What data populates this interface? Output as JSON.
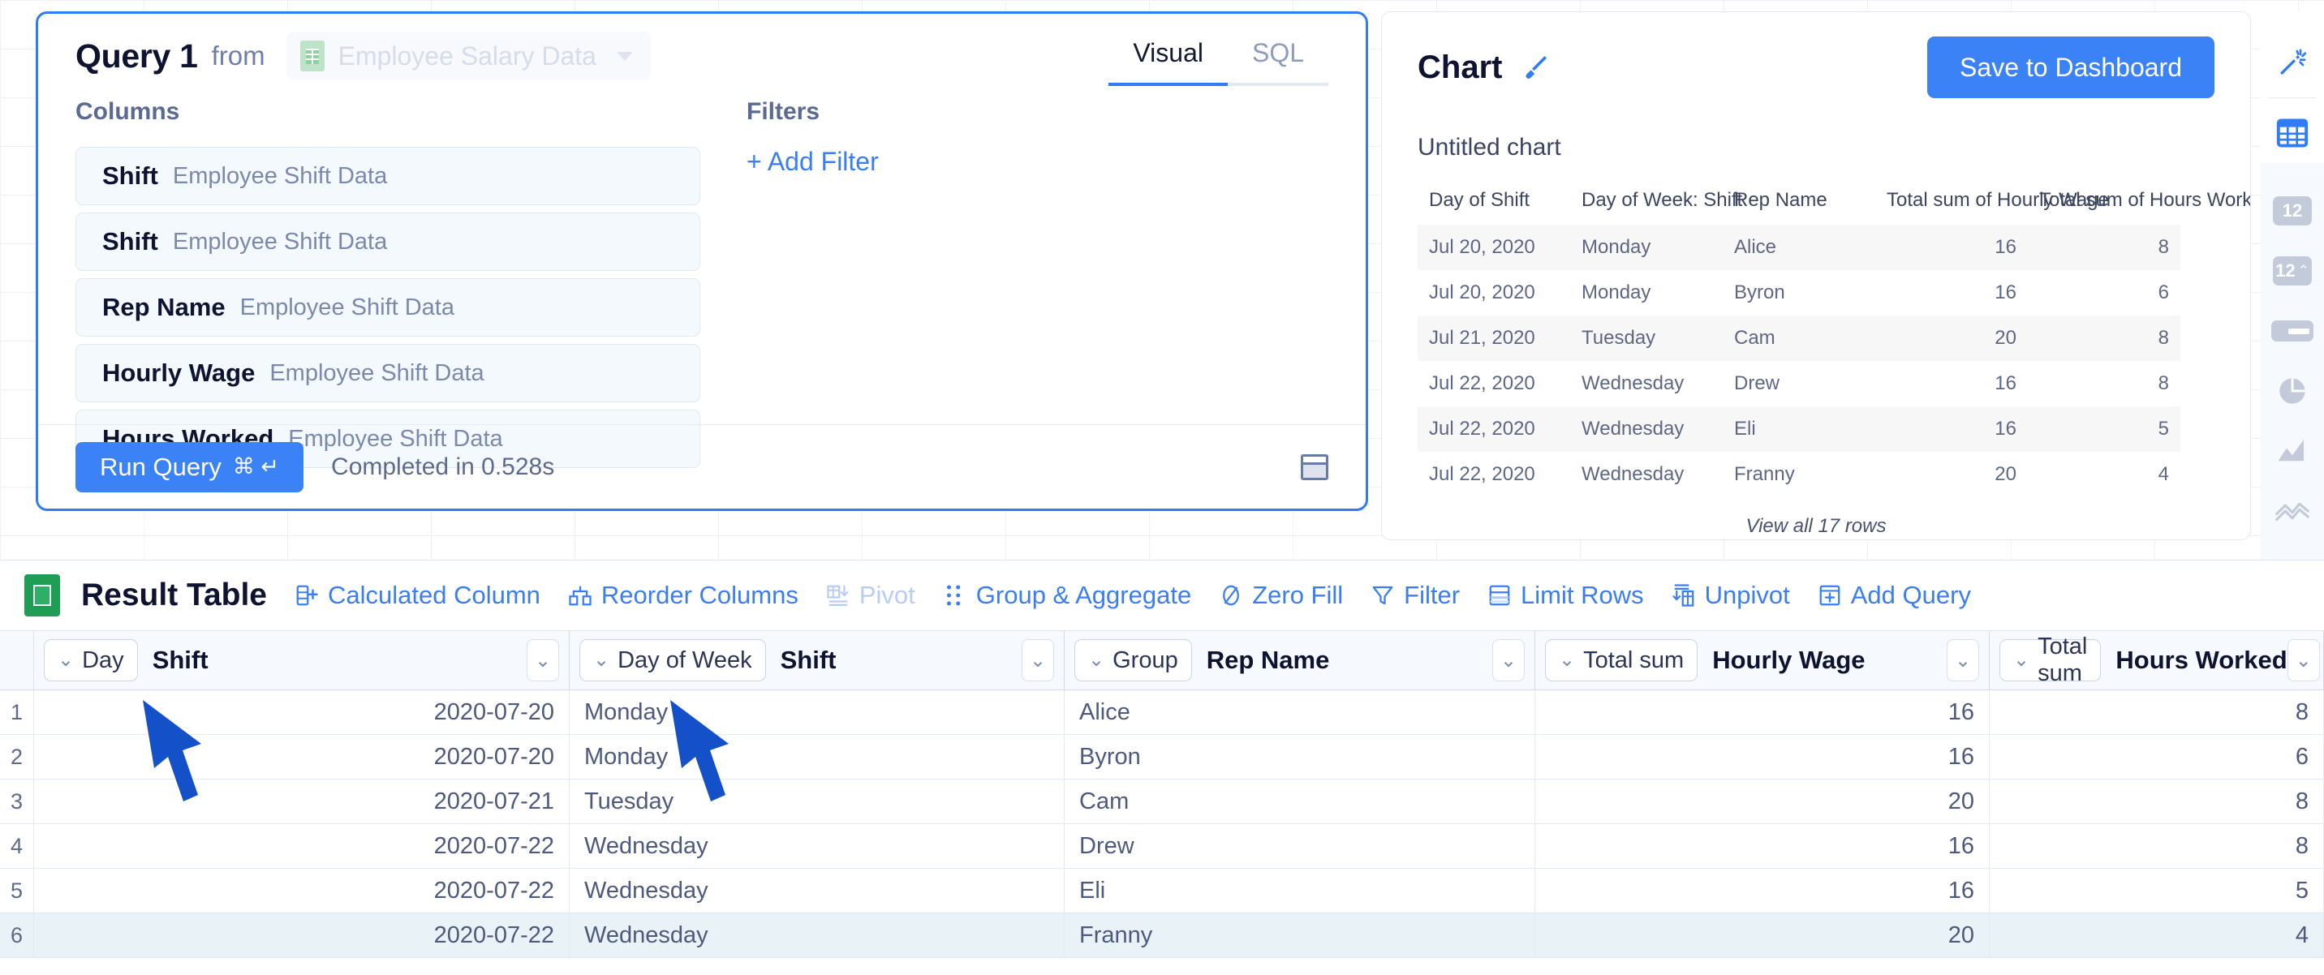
{
  "query": {
    "title": "Query 1",
    "from_label": "from",
    "source_name": "Employee Salary Data",
    "source_icon": "sheet-icon",
    "tabs": [
      {
        "label": "Visual",
        "active": true
      },
      {
        "label": "SQL",
        "active": false
      }
    ],
    "columns_label": "Columns",
    "columns": [
      {
        "name": "Shift",
        "source": "Employee Shift Data"
      },
      {
        "name": "Shift",
        "source": "Employee Shift Data"
      },
      {
        "name": "Rep Name",
        "source": "Employee Shift Data"
      },
      {
        "name": "Hourly Wage",
        "source": "Employee Shift Data"
      },
      {
        "name": "Hours Worked",
        "source": "Employee Shift Data"
      }
    ],
    "filters_label": "Filters",
    "add_filter_label": "+ Add Filter",
    "run_button_label": "Run Query",
    "run_button_shortcut": "⌘ ↵",
    "status": "Completed in 0.528s",
    "panel_toggle_icon": "panel-icon"
  },
  "chart": {
    "title": "Chart",
    "edit_icon": "paintbrush-icon",
    "save_button_label": "Save to Dashboard",
    "chart_name": "Untitled chart",
    "view_all_label": "View all 17 rows",
    "preview": {
      "headers": [
        "Day of Shift",
        "Day of Week: Shift",
        "Rep Name",
        "Total sum of Hourly Wage",
        "Total sum of Hours Worked"
      ],
      "rows": [
        [
          "Jul 20, 2020",
          "Monday",
          "Alice",
          "16",
          "8"
        ],
        [
          "Jul 20, 2020",
          "Monday",
          "Byron",
          "16",
          "6"
        ],
        [
          "Jul 21, 2020",
          "Tuesday",
          "Cam",
          "20",
          "8"
        ],
        [
          "Jul 22, 2020",
          "Wednesday",
          "Drew",
          "16",
          "8"
        ],
        [
          "Jul 22, 2020",
          "Wednesday",
          "Eli",
          "16",
          "5"
        ],
        [
          "Jul 22, 2020",
          "Wednesday",
          "Franny",
          "20",
          "4"
        ]
      ]
    }
  },
  "rail": {
    "items": [
      {
        "icon": "magic-wand-icon",
        "active": true
      },
      {
        "icon": "table-icon",
        "active": true
      },
      {
        "icon": "number-12-icon",
        "active": false,
        "label": "12"
      },
      {
        "icon": "number-12-trend-icon",
        "active": false,
        "label": "12"
      },
      {
        "icon": "progress-bar-icon",
        "active": false
      },
      {
        "icon": "pie-chart-icon",
        "active": false
      },
      {
        "icon": "area-chart-icon",
        "active": false
      },
      {
        "icon": "line-chart-icon",
        "active": false
      },
      {
        "icon": "chevron-down-icon",
        "active": false
      }
    ]
  },
  "result": {
    "icon": "google-sheets-icon",
    "title": "Result Table",
    "toolbar": [
      {
        "label": "Calculated Column",
        "icon": "calculated-column-icon",
        "disabled": false
      },
      {
        "label": "Reorder Columns",
        "icon": "reorder-columns-icon",
        "disabled": false
      },
      {
        "label": "Pivot",
        "icon": "pivot-icon",
        "disabled": true
      },
      {
        "label": "Group & Aggregate",
        "icon": "group-aggregate-icon",
        "disabled": false
      },
      {
        "label": "Zero Fill",
        "icon": "zero-fill-icon",
        "disabled": false
      },
      {
        "label": "Filter",
        "icon": "filter-icon",
        "disabled": false
      },
      {
        "label": "Limit Rows",
        "icon": "limit-rows-icon",
        "disabled": false
      },
      {
        "label": "Unpivot",
        "icon": "unpivot-icon",
        "disabled": false
      },
      {
        "label": "Add Query",
        "icon": "add-query-icon",
        "disabled": false
      }
    ],
    "grid_headers": [
      {
        "agg": "Day",
        "name": "Shift",
        "align": "right"
      },
      {
        "agg": "Day of Week",
        "name": "Shift",
        "align": "left"
      },
      {
        "agg": "Group",
        "name": "Rep Name",
        "align": "left"
      },
      {
        "agg": "Total sum",
        "name": "Hourly Wage",
        "align": "right"
      },
      {
        "agg": "Total sum",
        "name": "Hours Worked",
        "align": "right"
      }
    ],
    "rows": [
      {
        "n": "1",
        "cells": [
          "2020-07-20",
          "Monday",
          "Alice",
          "16",
          "8"
        ],
        "highlight": false
      },
      {
        "n": "2",
        "cells": [
          "2020-07-20",
          "Monday",
          "Byron",
          "16",
          "6"
        ],
        "highlight": false
      },
      {
        "n": "3",
        "cells": [
          "2020-07-21",
          "Tuesday",
          "Cam",
          "20",
          "8"
        ],
        "highlight": false
      },
      {
        "n": "4",
        "cells": [
          "2020-07-22",
          "Wednesday",
          "Drew",
          "16",
          "8"
        ],
        "highlight": false
      },
      {
        "n": "5",
        "cells": [
          "2020-07-22",
          "Wednesday",
          "Eli",
          "16",
          "5"
        ],
        "highlight": false
      },
      {
        "n": "6",
        "cells": [
          "2020-07-22",
          "Wednesday",
          "Franny",
          "20",
          "4"
        ],
        "highlight": true
      }
    ]
  },
  "annotations": {
    "arrow_color": "#1450c8",
    "arrows": [
      {
        "name": "arrow-to-day-header"
      },
      {
        "name": "arrow-to-day-of-week-header"
      }
    ]
  }
}
